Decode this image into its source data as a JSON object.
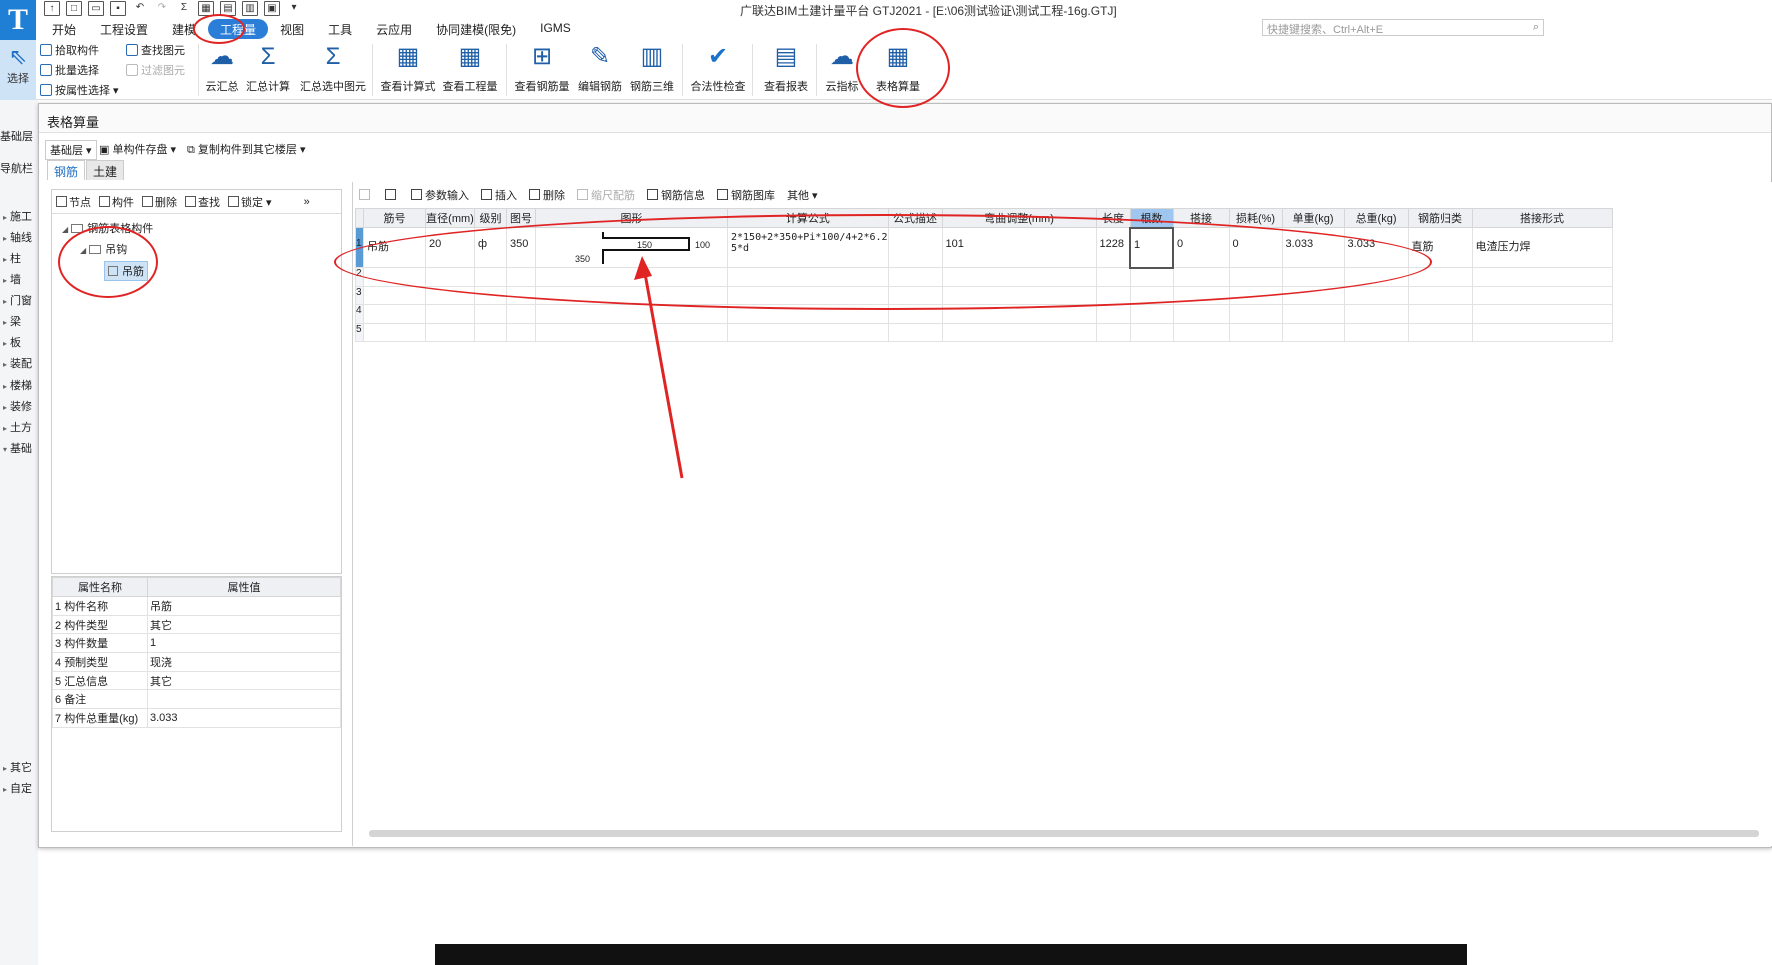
{
  "app": {
    "title": "广联达BIM土建计量平台 GTJ2021 - [E:\\06测试验证\\测试工程-16g.GTJ]",
    "menu": [
      "开始",
      "工程设置",
      "建模",
      "工程量",
      "视图",
      "工具",
      "云应用",
      "协同建模(限免)",
      "IGMS"
    ],
    "active_menu": "工程量",
    "search_placeholder": "快捷键搜索、Ctrl+Alt+E"
  },
  "ribbon": {
    "select_label": "选择",
    "small_tools": {
      "pick": "拾取构件",
      "batch": "批量选择",
      "by_attr": "按属性选择",
      "find": "查找图元",
      "filter": "过滤图元"
    },
    "big_tools": [
      "云汇总",
      "汇总计算",
      "汇总选中图元",
      "查看计算式",
      "查看工程量",
      "查看钢筋量",
      "编辑钢筋",
      "钢筋三维",
      "合法性检查",
      "查看报表",
      "云指标",
      "表格算量"
    ]
  },
  "left_nav": {
    "floor": "基础层",
    "nav": "导航栏",
    "items": [
      "施工",
      "轴线",
      "柱",
      "墙",
      "门窗",
      "梁",
      "板",
      "装配",
      "楼梯",
      "装修",
      "土方",
      "基础",
      "其它",
      "自定"
    ]
  },
  "dialog": {
    "title": "表格算量",
    "floor_dropdown": "基础层",
    "save_label": "单构件存盘",
    "copy_label": "复制构件到其它楼层",
    "tabs": [
      "钢筋",
      "土建"
    ],
    "tree_toolbar": [
      "节点",
      "构件",
      "删除",
      "查找",
      "锁定"
    ],
    "tree": {
      "root": "钢筋表格构件",
      "child": "吊钩",
      "leaf": "吊筋"
    },
    "properties": {
      "headers": [
        "属性名称",
        "属性值"
      ],
      "rows": [
        {
          "no": "1",
          "name": "构件名称",
          "value": "吊筋"
        },
        {
          "no": "2",
          "name": "构件类型",
          "value": "其它"
        },
        {
          "no": "3",
          "name": "构件数量",
          "value": "1"
        },
        {
          "no": "4",
          "name": "预制类型",
          "value": "现浇"
        },
        {
          "no": "5",
          "name": "汇总信息",
          "value": "其它"
        },
        {
          "no": "6",
          "name": "备注",
          "value": ""
        },
        {
          "no": "7",
          "name": "构件总重量(kg)",
          "value": "3.033"
        }
      ]
    },
    "grid_toolbar": [
      "参数输入",
      "插入",
      "删除",
      "缩尺配筋",
      "钢筋信息",
      "钢筋图库",
      "其他"
    ],
    "grid": {
      "headers": [
        "筋号",
        "直径(mm)",
        "级别",
        "图号",
        "图形",
        "计算公式",
        "公式描述",
        "弯曲调整(mm)",
        "长度",
        "根数",
        "搭接",
        "损耗(%)",
        "单重(kg)",
        "总重(kg)",
        "钢筋归类",
        "搭接形式"
      ],
      "row1": {
        "no": "1",
        "bar_no": "吊筋",
        "diameter": "20",
        "grade": "ф",
        "figure_no": "350",
        "shape_mid": "150",
        "shape_right": "100",
        "shape_left": "350",
        "formula_line1": "2*150+2*350+Pi*100/4+2*6.2",
        "formula_line2": "5*d",
        "formula_desc": "",
        "bend_adjust": "101",
        "length": "1228",
        "count": "1",
        "lap": "0",
        "loss": "0",
        "unit_weight": "3.033",
        "total_weight": "3.033",
        "category": "直筋",
        "lap_type": "电渣压力焊"
      },
      "empty_rows": [
        "2",
        "3",
        "4",
        "5"
      ]
    }
  },
  "annotation_color": "#e02424"
}
